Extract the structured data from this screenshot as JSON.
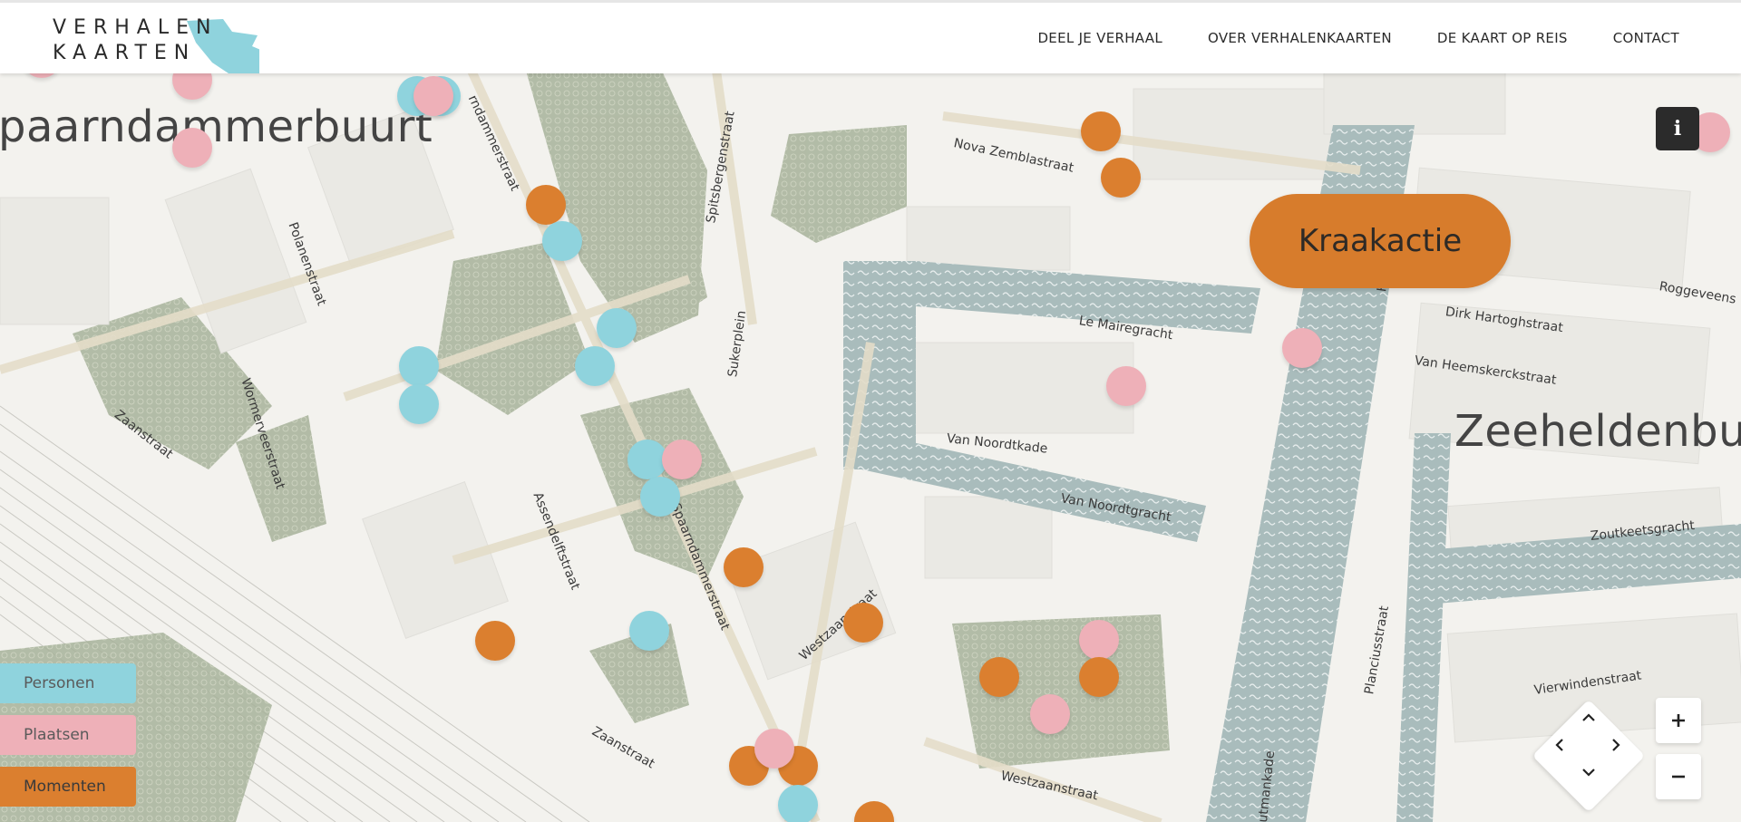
{
  "brand": {
    "line1": "VERHALEN",
    "line2": "KAARTEN",
    "water_color": "#8fd3dd"
  },
  "nav": [
    {
      "label": "DEEL JE VERHAAL"
    },
    {
      "label": "OVER VERHALENKAARTEN"
    },
    {
      "label": "DE KAART OP REIS"
    },
    {
      "label": "CONTACT"
    }
  ],
  "map": {
    "districts": {
      "spaarndammerbuurt": "paarndammerbuurt",
      "zeeheldenbuurt": "Zeeheldenbuu"
    },
    "streets": {
      "spaarndammerstraat_top": "rndammerstraat",
      "nova_zemblastraat": "Nova Zemblastraat",
      "spitsbergenstraat": "Spitsbergenstraat",
      "polanenstraat": "Polanenstraat",
      "sukerplein": "Sukerplein",
      "le_mairegracht": "Le Mairegracht",
      "dirk_hartoghstraat": "Dirk Hartoghstraat",
      "roggeveenstraat": "Roggeveens",
      "van_heemskerckstraat": "Van Heemskerckstraat",
      "wormerveerstraat": "Wormerveerstraat",
      "zaanstraat_left": "Zaanstraat",
      "van_noordtkade": "Van Noordtkade",
      "van_noordtgracht": "Van Noordtgracht",
      "assendelftstraat": "Assendelftstraat",
      "spaarndammerstraat": "Spaarndammerstraat",
      "zoutkeetsgracht": "Zoutkeetsgracht",
      "westzaanstraat": "Westzaanstraat",
      "planciusstraat": "Planciusstraat",
      "vierwindenstraat": "Vierwindenstraat",
      "zaanstraat_bottom": "Zaanstraat",
      "westzaanstraat_bottom": "Westzaanstraat",
      "houtmankade": "outmankade",
      "hembrugstraat": "H"
    },
    "featured_label": "Kraakactie",
    "colors": {
      "personen": "#8fd3dd",
      "plaatsen": "#eeb0b8",
      "momenten": "#db7f2f",
      "water": "#a9bcbc",
      "green": "#a7b29a",
      "ground": "#f3f2ee"
    },
    "marker_count": 46
  },
  "legend": {
    "personen": "Personen",
    "plaatsen": "Plaatsen",
    "momenten": "Momenten"
  },
  "controls": {
    "info_icon": "info-icon",
    "pan_icons": [
      "chevron-up-icon",
      "chevron-left-icon",
      "chevron-right-icon",
      "chevron-down-icon"
    ],
    "zoom_in_icon": "plus-icon",
    "zoom_out_icon": "minus-icon"
  }
}
